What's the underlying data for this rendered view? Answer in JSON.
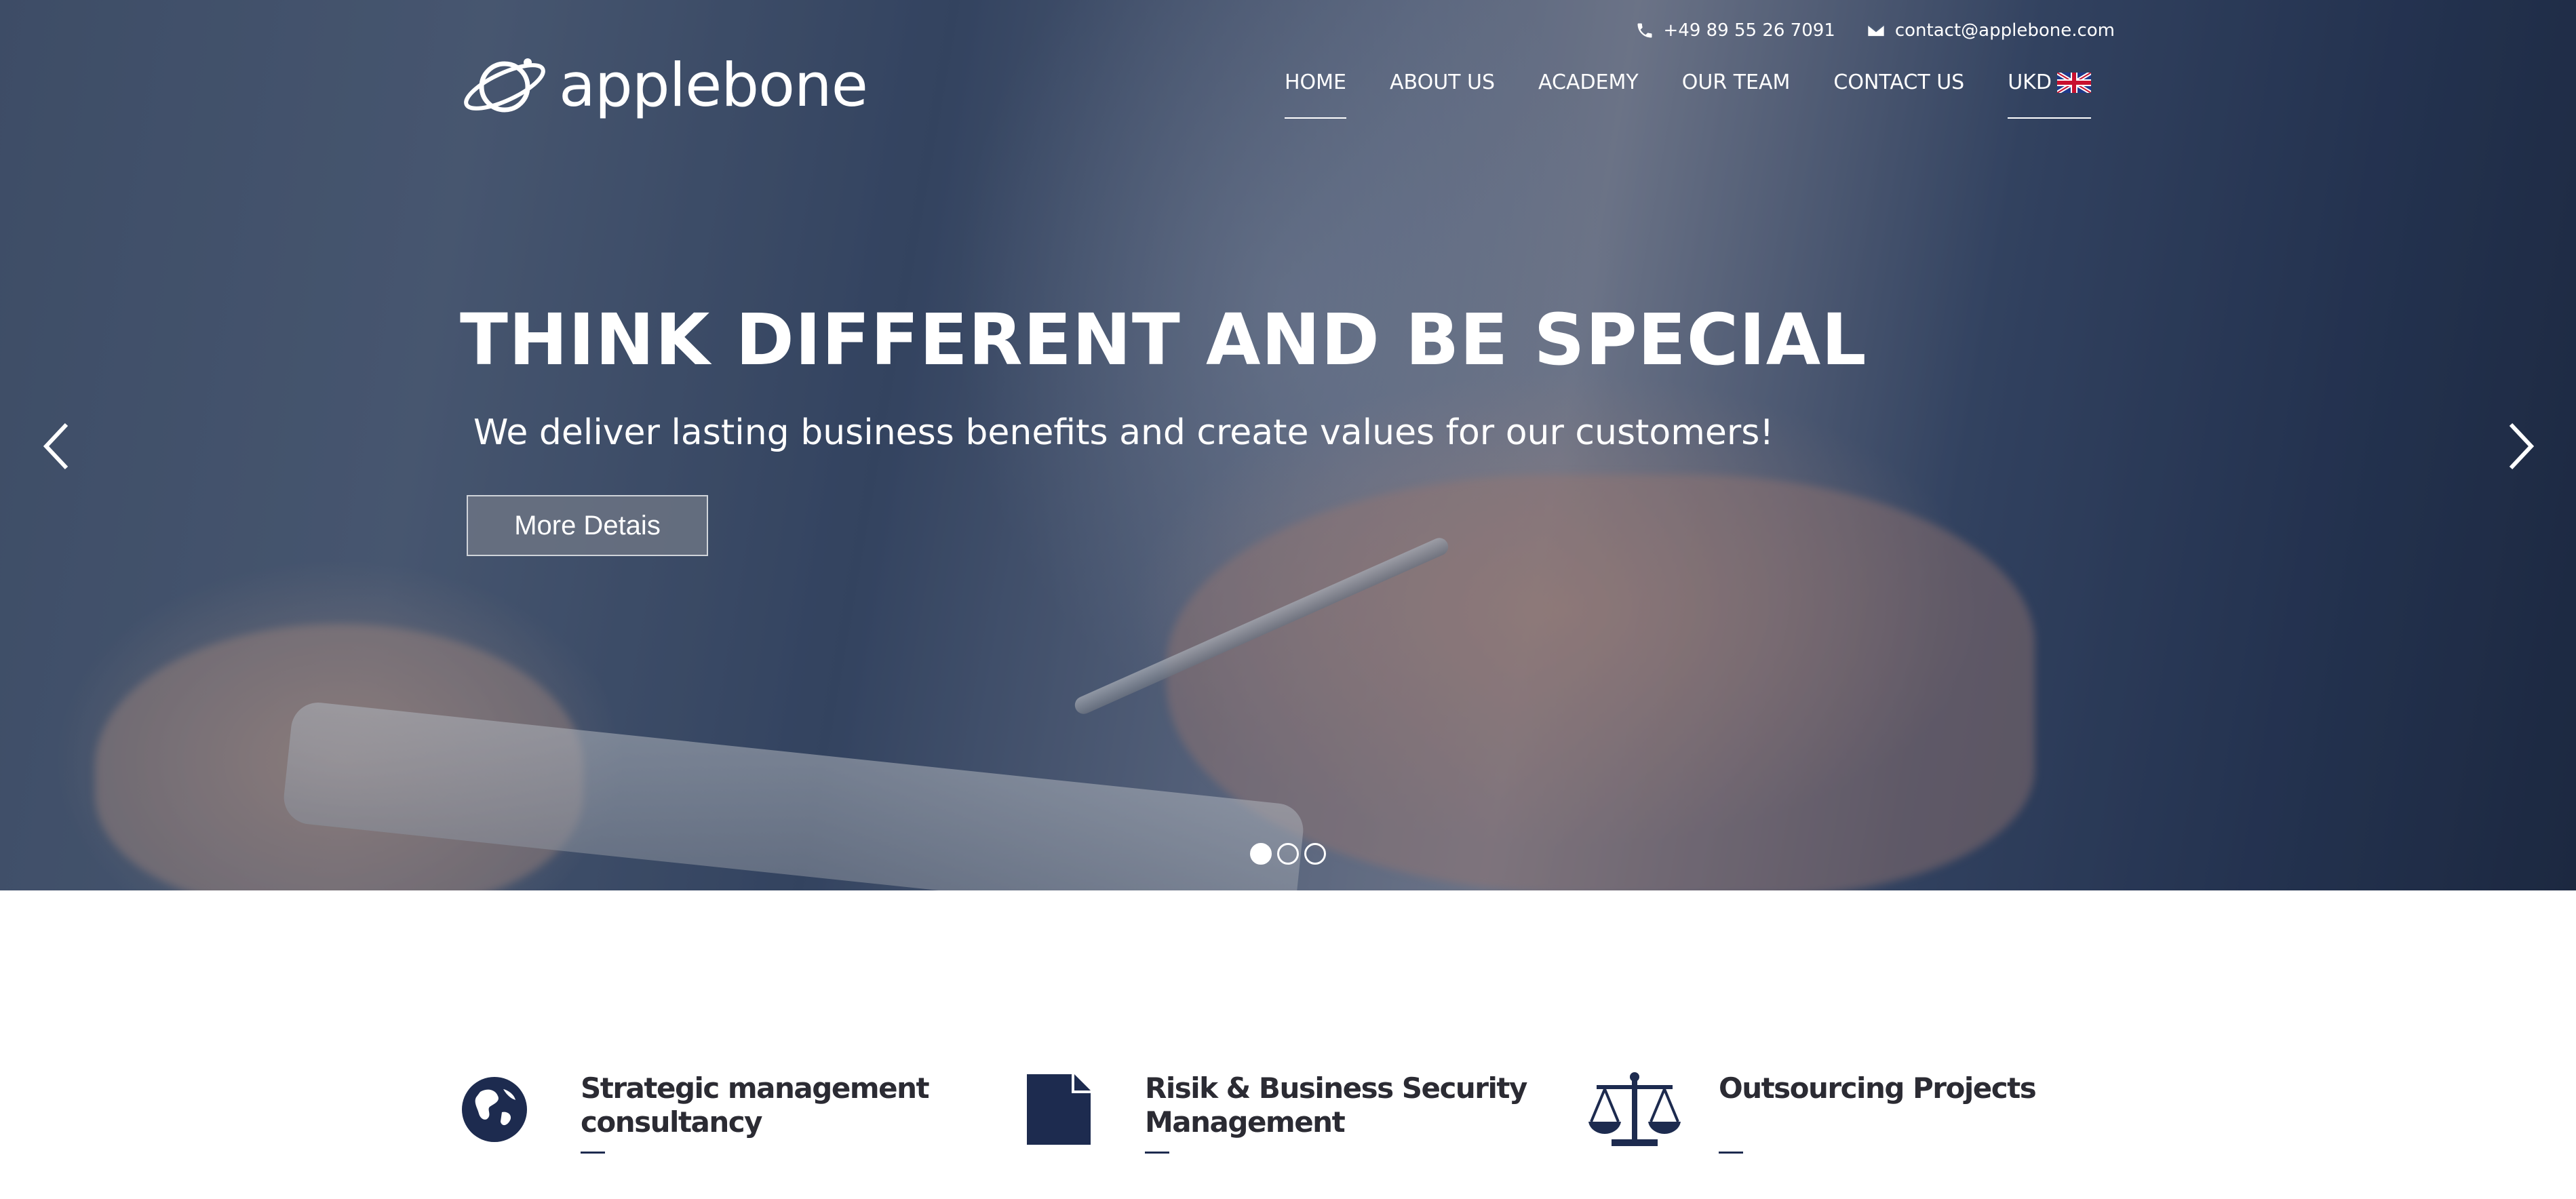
{
  "topbar": {
    "phone": "+49 89 55 26 7091",
    "email": "contact@applebone.com"
  },
  "logo": {
    "name": "applebone"
  },
  "nav": {
    "items": [
      {
        "label": "HOME",
        "active": true
      },
      {
        "label": "ABOUT US",
        "active": false
      },
      {
        "label": "ACADEMY",
        "active": false
      },
      {
        "label": "OUR TEAM",
        "active": false
      },
      {
        "label": "CONTACT US",
        "active": false
      },
      {
        "label": "UKD",
        "active": true
      }
    ],
    "flag_icon": "uk-flag-icon"
  },
  "hero": {
    "headline": "THINK DIFFERENT AND BE SPECIAL",
    "subline": "We deliver lasting business benefits and create values for our customers!",
    "cta_label": "More Detais",
    "slides_total": 3,
    "active_slide": 1
  },
  "services": [
    {
      "icon": "globe-icon",
      "line1": "Strategic management",
      "line2": "consultancy"
    },
    {
      "icon": "document-icon",
      "line1": "Risik & Business Security",
      "line2": "Management"
    },
    {
      "icon": "scales-icon",
      "line1": "Outsourcing Projects",
      "line2": ""
    }
  ],
  "colors": {
    "accent": "#1d2b4f",
    "heading": "#2b2b33",
    "hero_text": "#ffffff"
  }
}
